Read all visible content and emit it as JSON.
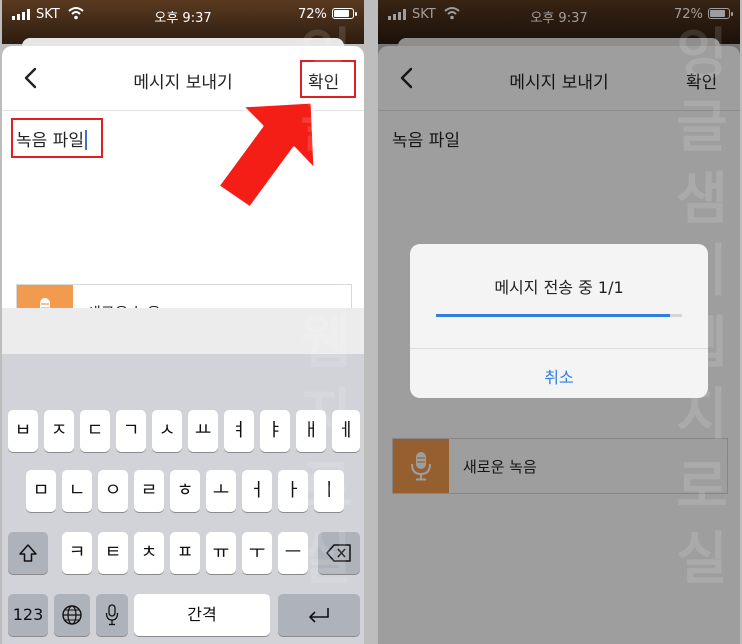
{
  "status": {
    "carrier": "SKT",
    "time": "오후 9:37",
    "battery": "72%"
  },
  "nav": {
    "title": "메시지 보내기",
    "confirm": "확인"
  },
  "message": {
    "text": "녹음 파일"
  },
  "recording": {
    "label": "새로운 녹음"
  },
  "keyboard": {
    "row1": [
      "ㅂ",
      "ㅈ",
      "ㄷ",
      "ㄱ",
      "ㅅ",
      "ㅛ",
      "ㅕ",
      "ㅑ",
      "ㅐ",
      "ㅔ"
    ],
    "row2": [
      "ㅁ",
      "ㄴ",
      "ㅇ",
      "ㄹ",
      "ㅎ",
      "ㅗ",
      "ㅓ",
      "ㅏ",
      "ㅣ"
    ],
    "row3": [
      "ㅋ",
      "ㅌ",
      "ㅊ",
      "ㅍ",
      "ㅠ",
      "ㅜ",
      "ㅡ"
    ],
    "num_key": "123",
    "space": "간격"
  },
  "dialog": {
    "title": "메시지 전송 중 1/1",
    "cancel": "취소",
    "progress_percent": 95
  },
  "colors": {
    "accent": "#f29a4d",
    "highlight": "#e02020",
    "link": "#2f7fe0"
  }
}
